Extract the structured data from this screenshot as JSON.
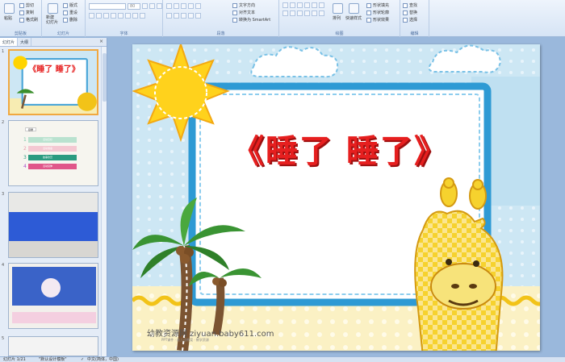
{
  "ribbon": {
    "clipboard": {
      "paste": "粘贴",
      "cut": "剪切",
      "copy": "复制",
      "format_painter": "格式刷",
      "label": "剪贴板"
    },
    "slides": {
      "new_slide": "新建\n幻灯片",
      "layout": "版式",
      "reset": "重设",
      "delete": "删除",
      "label": "幻灯片"
    },
    "font": {
      "size": "80",
      "label": "字体"
    },
    "paragraph": {
      "text_direction": "文字方向",
      "align_text": "对齐文本",
      "smartart": "转换为 SmartArt",
      "label": "段落"
    },
    "drawing": {
      "arrange": "排列",
      "quick_styles": "快速样式",
      "shape_fill": "形状填充",
      "shape_outline": "形状轮廓",
      "shape_effects": "形状效果",
      "label": "绘图"
    },
    "editing": {
      "find": "查找",
      "replace": "替换",
      "select": "选择",
      "label": "编辑"
    }
  },
  "panel": {
    "tab_slides": "幻灯片",
    "tab_outline": "大纲",
    "close": "×",
    "thumbs": [
      {
        "num": "1",
        "title": "《睡了 睡了》"
      },
      {
        "num": "2",
        "heading": "目录",
        "items": [
          "1",
          "2",
          "3",
          "4"
        ],
        "labels": [
          "活动目标",
          "活动准备",
          "故事欣赏",
          "活动延伸"
        ]
      },
      {
        "num": "3"
      },
      {
        "num": "4"
      },
      {
        "num": "5"
      }
    ]
  },
  "slide": {
    "title": "《睡了  睡了》",
    "watermark": "幼教资源网 ziyuan.baby611.com",
    "watermark_small": "PPT课件 · 幼儿园教案 · 教学资源"
  },
  "status": {
    "slide_count": "幻灯片 1/21",
    "theme": "\"默认设计模板\"",
    "language": "中文(简体，中国)"
  },
  "colors": {
    "accent": "#e61f1f",
    "ribbon": "#d6e4f5",
    "workspace": "#9ab8dc"
  }
}
